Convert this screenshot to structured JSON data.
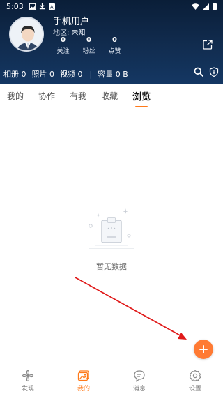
{
  "status_bar": {
    "time": "5:03"
  },
  "profile": {
    "username": "手机用户",
    "region": "地区: 未知",
    "stats": [
      {
        "value": "0",
        "label": "关注"
      },
      {
        "value": "0",
        "label": "粉丝"
      },
      {
        "value": "0",
        "label": "点赞"
      }
    ]
  },
  "summary": {
    "albums": "相册 0",
    "photos": "照片 0",
    "videos": "视频 0",
    "divider": "|",
    "capacity": "容量 0 B"
  },
  "tabs": [
    {
      "label": "我的",
      "active": false
    },
    {
      "label": "协作",
      "active": false
    },
    {
      "label": "有我",
      "active": false
    },
    {
      "label": "收藏",
      "active": false
    },
    {
      "label": "浏览",
      "active": true
    }
  ],
  "empty_state": {
    "text": "暂无数据"
  },
  "bottom_nav": [
    {
      "label": "发现",
      "icon": "pinwheel-icon",
      "active": false
    },
    {
      "label": "我的",
      "icon": "album-icon",
      "active": true
    },
    {
      "label": "消息",
      "icon": "chat-icon",
      "active": false
    },
    {
      "label": "设置",
      "icon": "gear-icon",
      "active": false
    }
  ],
  "colors": {
    "header_bg": "#0f2747",
    "accent": "#ff7a1a",
    "fab": "#ff7a33",
    "arrow": "#e01a1a"
  }
}
